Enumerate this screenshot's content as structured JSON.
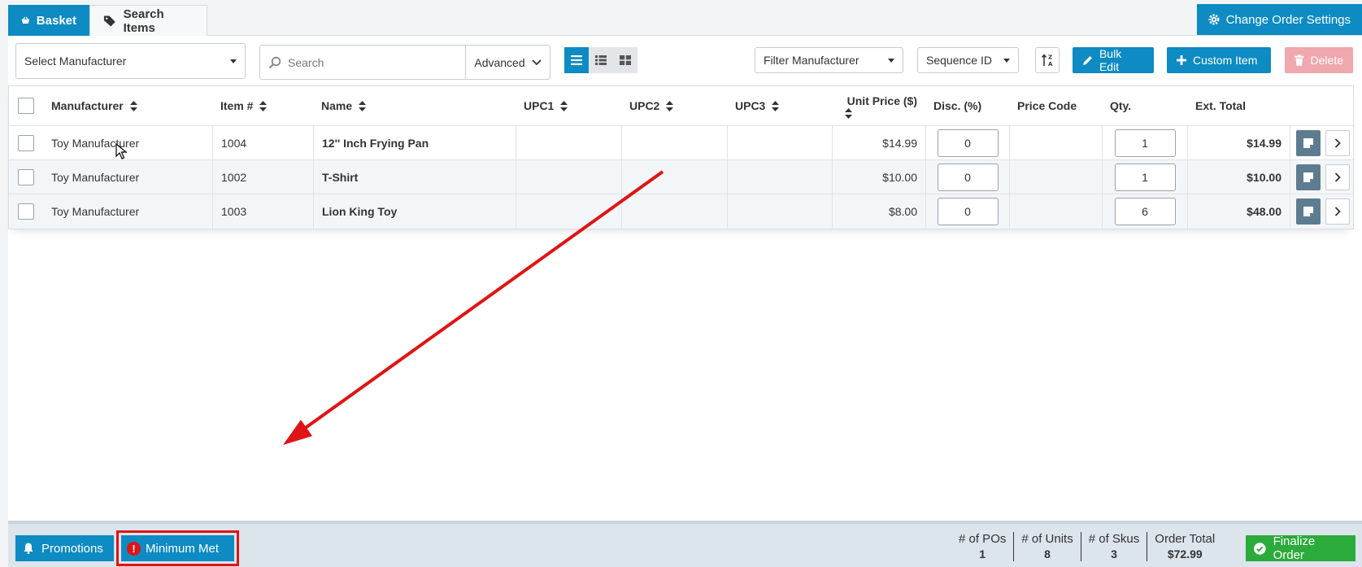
{
  "tabs": {
    "basket": "Basket",
    "search_items": "Search Items"
  },
  "header": {
    "settings_label": "Change Order Settings"
  },
  "toolbar": {
    "manufacturer_select": "Select Manufacturer",
    "search_placeholder": "Search",
    "advanced_label": "Advanced",
    "filter_manufacturer": "Filter Manufacturer",
    "sequence_select": "Sequence ID",
    "bulk_edit": "Bulk Edit",
    "custom_item": "Custom Item",
    "delete": "Delete"
  },
  "columns": {
    "manufacturer": "Manufacturer",
    "item": "Item #",
    "name": "Name",
    "upc1": "UPC1",
    "upc2": "UPC2",
    "upc3": "UPC3",
    "unit_price": "Unit Price ($)",
    "disc": "Disc. (%)",
    "price_code": "Price Code",
    "qty": "Qty.",
    "ext_total": "Ext. Total"
  },
  "rows": [
    {
      "manufacturer": "Toy Manufacturer",
      "item": "1004",
      "name": "12'' Inch Frying Pan",
      "upc1": "",
      "upc2": "",
      "upc3": "",
      "unit_price": "$14.99",
      "disc": "0",
      "price_code": "",
      "qty": "1",
      "ext_total": "$14.99"
    },
    {
      "manufacturer": "Toy Manufacturer",
      "item": "1002",
      "name": "T-Shirt",
      "upc1": "",
      "upc2": "",
      "upc3": "",
      "unit_price": "$10.00",
      "disc": "0",
      "price_code": "",
      "qty": "1",
      "ext_total": "$10.00"
    },
    {
      "manufacturer": "Toy Manufacturer",
      "item": "1003",
      "name": "Lion King Toy",
      "upc1": "",
      "upc2": "",
      "upc3": "",
      "unit_price": "$8.00",
      "disc": "0",
      "price_code": "",
      "qty": "6",
      "ext_total": "$48.00"
    }
  ],
  "footer": {
    "promotions": "Promotions",
    "minimum_met": "Minimum Met",
    "pos_label": "# of POs",
    "pos_value": "1",
    "units_label": "# of Units",
    "units_value": "8",
    "skus_label": "# of Skus",
    "skus_value": "3",
    "total_label": "Order Total",
    "total_value": "$72.99",
    "finalize": "Finalize Order"
  },
  "icons": {
    "basket": "basket-icon",
    "tags": "tags-icon",
    "gear": "gear-icon",
    "search": "search-icon",
    "list_view": "list-view-icon",
    "detail_view": "detail-view-icon",
    "grid_view": "grid-view-icon",
    "sort_az": "sort-az-icon",
    "pencil": "pencil-icon",
    "plus": "plus-icon",
    "trash": "trash-icon",
    "sort": "sort-icon",
    "note": "note-icon",
    "chevron_right": "chevron-right-icon",
    "bell": "bell-icon",
    "alert": "alert-icon",
    "check_circle": "check-circle-icon"
  },
  "colors": {
    "primary": "#0d8bc2",
    "success": "#2bab3a",
    "danger": "#e01414",
    "danger_light": "#f0a7ad",
    "footer_bg": "#dce4ec"
  }
}
